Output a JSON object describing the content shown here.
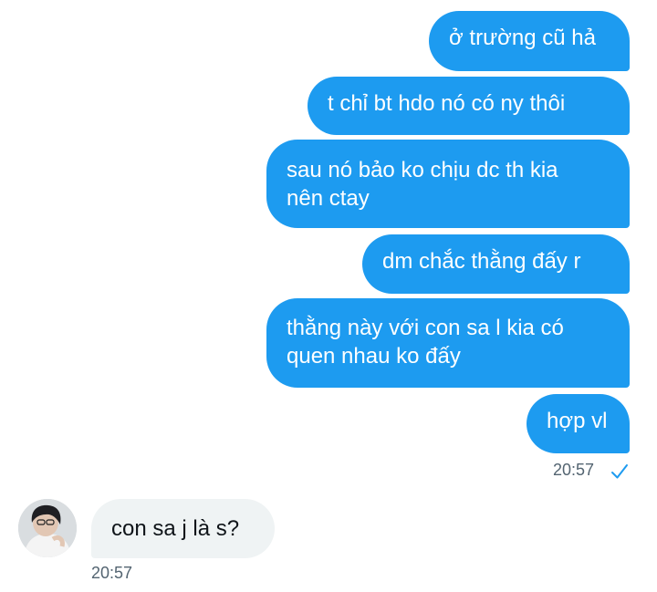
{
  "outgoing_messages": [
    "ở trường cũ hả",
    "t chỉ bt hdo nó có ny thôi",
    "sau nó bảo ko chịu dc th kia\nnên ctay",
    "dm chắc thằng đấy r",
    "thằng này với con sa l kia có\nquen nhau ko đấy",
    "hợp vl"
  ],
  "outgoing_time": "20:57",
  "incoming_messages": [
    "con sa j là s?"
  ],
  "incoming_time": "20:57",
  "colors": {
    "outgoing_bubble": "#1d9bf0",
    "incoming_bubble": "#eff3f4",
    "timestamp": "#536471"
  },
  "icons": {
    "read_receipt": "checkmark-icon",
    "contact_avatar": "avatar"
  }
}
